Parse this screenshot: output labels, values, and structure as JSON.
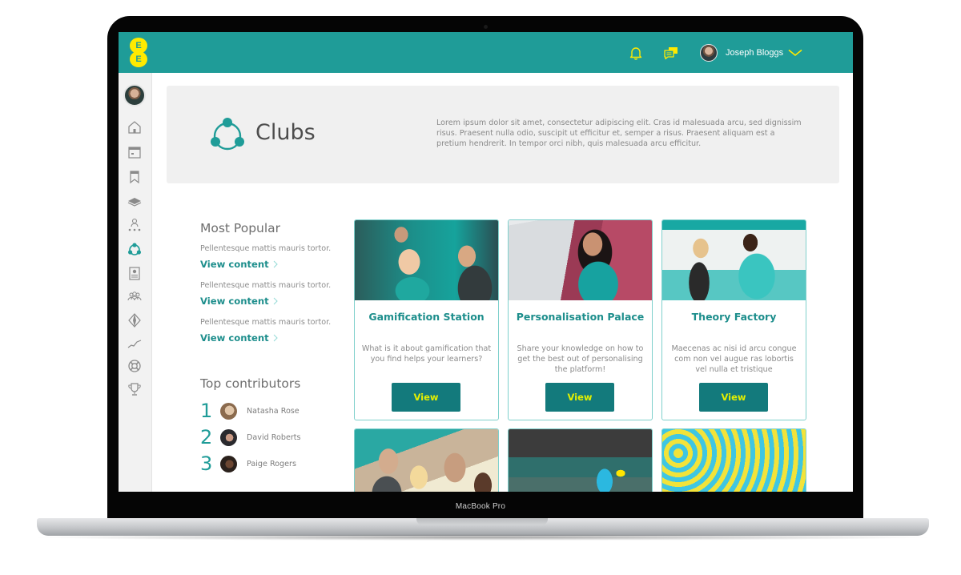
{
  "device": {
    "label": "MacBook Pro"
  },
  "header": {
    "logo_letters": [
      "E",
      "E"
    ],
    "notifications_icon": "bell-icon",
    "messages_icon": "chat-icon",
    "user": {
      "name": "Joseph Bloggs",
      "menu_icon": "chevron-down-icon"
    }
  },
  "sidebar": {
    "items": [
      {
        "name": "home",
        "icon": "home-icon",
        "active": false
      },
      {
        "name": "calendar",
        "icon": "calendar-icon",
        "active": false
      },
      {
        "name": "bookmarks",
        "icon": "bookmark-icon",
        "active": false
      },
      {
        "name": "learning",
        "icon": "book-icon",
        "active": false
      },
      {
        "name": "hierarchy",
        "icon": "org-chart-icon",
        "active": false
      },
      {
        "name": "clubs",
        "icon": "clubs-icon",
        "active": true
      },
      {
        "name": "clipboard",
        "icon": "clipboard-icon",
        "active": false
      },
      {
        "name": "community",
        "icon": "people-icon",
        "active": false
      },
      {
        "name": "explore",
        "icon": "diamond-icon",
        "active": false
      },
      {
        "name": "progress",
        "icon": "trend-icon",
        "active": false
      },
      {
        "name": "support",
        "icon": "lifebuoy-icon",
        "active": false
      },
      {
        "name": "achievements",
        "icon": "trophy-icon",
        "active": false
      }
    ]
  },
  "hero": {
    "title": "Clubs",
    "description": "Lorem ipsum dolor sit amet, consectetur adipiscing elit. Cras id malesuada arcu, sed dignissim risus. Praesent nulla odio, suscipit ut efficitur et, semper a risus. Praesent aliquam est a pretium hendrerit. In tempor orci nibh, quis malesuada arcu efficitur."
  },
  "most_popular": {
    "title": "Most Popular",
    "items": [
      {
        "text": "Pellentesque mattis mauris tortor.",
        "link": "View content"
      },
      {
        "text": "Pellentesque mattis mauris tortor.",
        "link": "View content"
      },
      {
        "text": "Pellentesque mattis mauris tortor.",
        "link": "View content"
      }
    ]
  },
  "top_contributors": {
    "title": "Top contributors",
    "items": [
      {
        "rank": "1",
        "name": "Natasha Rose"
      },
      {
        "rank": "2",
        "name": "David Roberts"
      },
      {
        "rank": "3",
        "name": "Paige Rogers"
      }
    ]
  },
  "clubs": [
    {
      "title": "Gamification Station",
      "description": "What is it about gamification that you find helps your learners?",
      "button": "View"
    },
    {
      "title": "Personalisation Palace",
      "description": "Share your knowledge on how to get the best out of personalising the platform!",
      "button": "View"
    },
    {
      "title": "Theory Factory",
      "description": "Maecenas ac nisi id arcu congue com non vel augue ras lobortis vel nulla et tristique",
      "button": "View"
    }
  ],
  "colors": {
    "brand_teal": "#1f9c98",
    "brand_yellow": "#ffea00",
    "button_teal": "#137a7c",
    "button_text": "#e4f000",
    "link_teal": "#1d8e8c"
  }
}
